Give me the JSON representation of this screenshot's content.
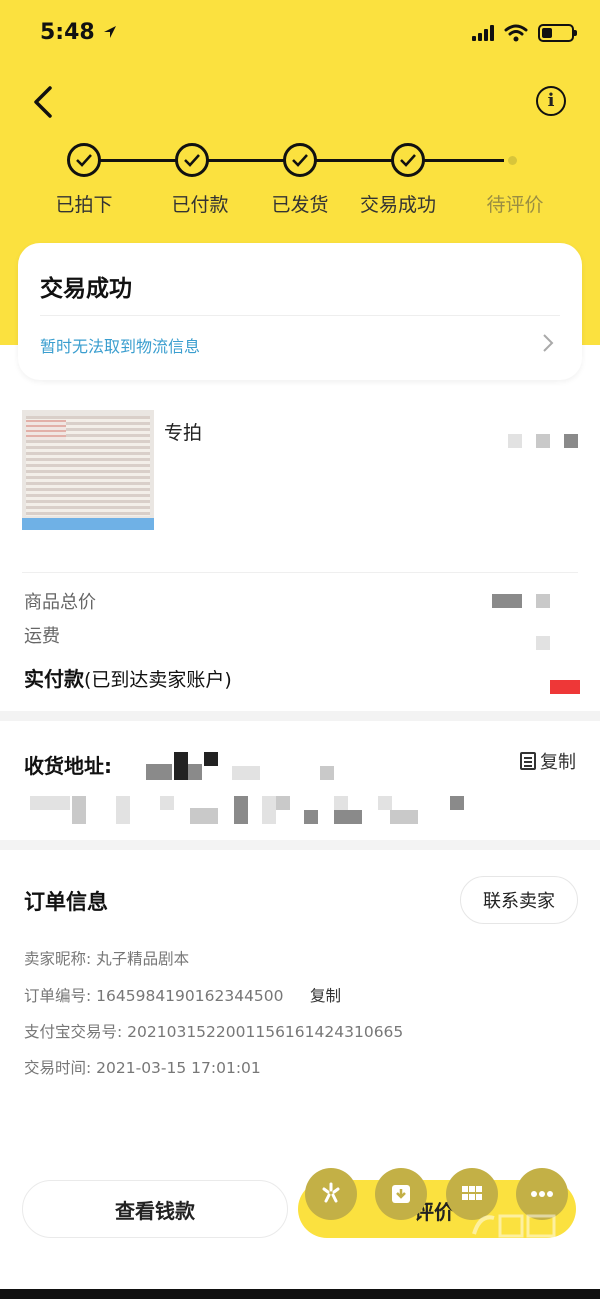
{
  "status_bar": {
    "time": "5:48"
  },
  "steps": [
    {
      "label": "已拍下",
      "done": true
    },
    {
      "label": "已付款",
      "done": true
    },
    {
      "label": "已发货",
      "done": true
    },
    {
      "label": "交易成功",
      "done": true
    },
    {
      "label": "待评价",
      "done": false
    }
  ],
  "status_card": {
    "title": "交易成功",
    "logistics": "暂时无法取到物流信息"
  },
  "product": {
    "name": "专拍"
  },
  "price": {
    "goods_total_label": "商品总价",
    "shipping_label": "运费",
    "paid_label": "实付款",
    "paid_note": "(已到达卖家账户)"
  },
  "address": {
    "label": "收货地址:",
    "copy_label": "复制"
  },
  "order": {
    "title": "订单信息",
    "contact_label": "联系卖家",
    "seller_line": "卖家昵称: 丸子精品剧本",
    "order_no_line": "订单编号: 1645984190162344500",
    "order_no_copy": "复制",
    "alipay_line": "支付宝交易号: 2021031522001156161424310665",
    "time_line": "交易时间: 2021-03-15 17:01:01"
  },
  "footer": {
    "view_money": "查看钱款",
    "review": "评价"
  },
  "colors": {
    "brand_yellow": "#fbe13f",
    "link_blue": "#3a9ecf",
    "accent_red": "#ee3737"
  }
}
